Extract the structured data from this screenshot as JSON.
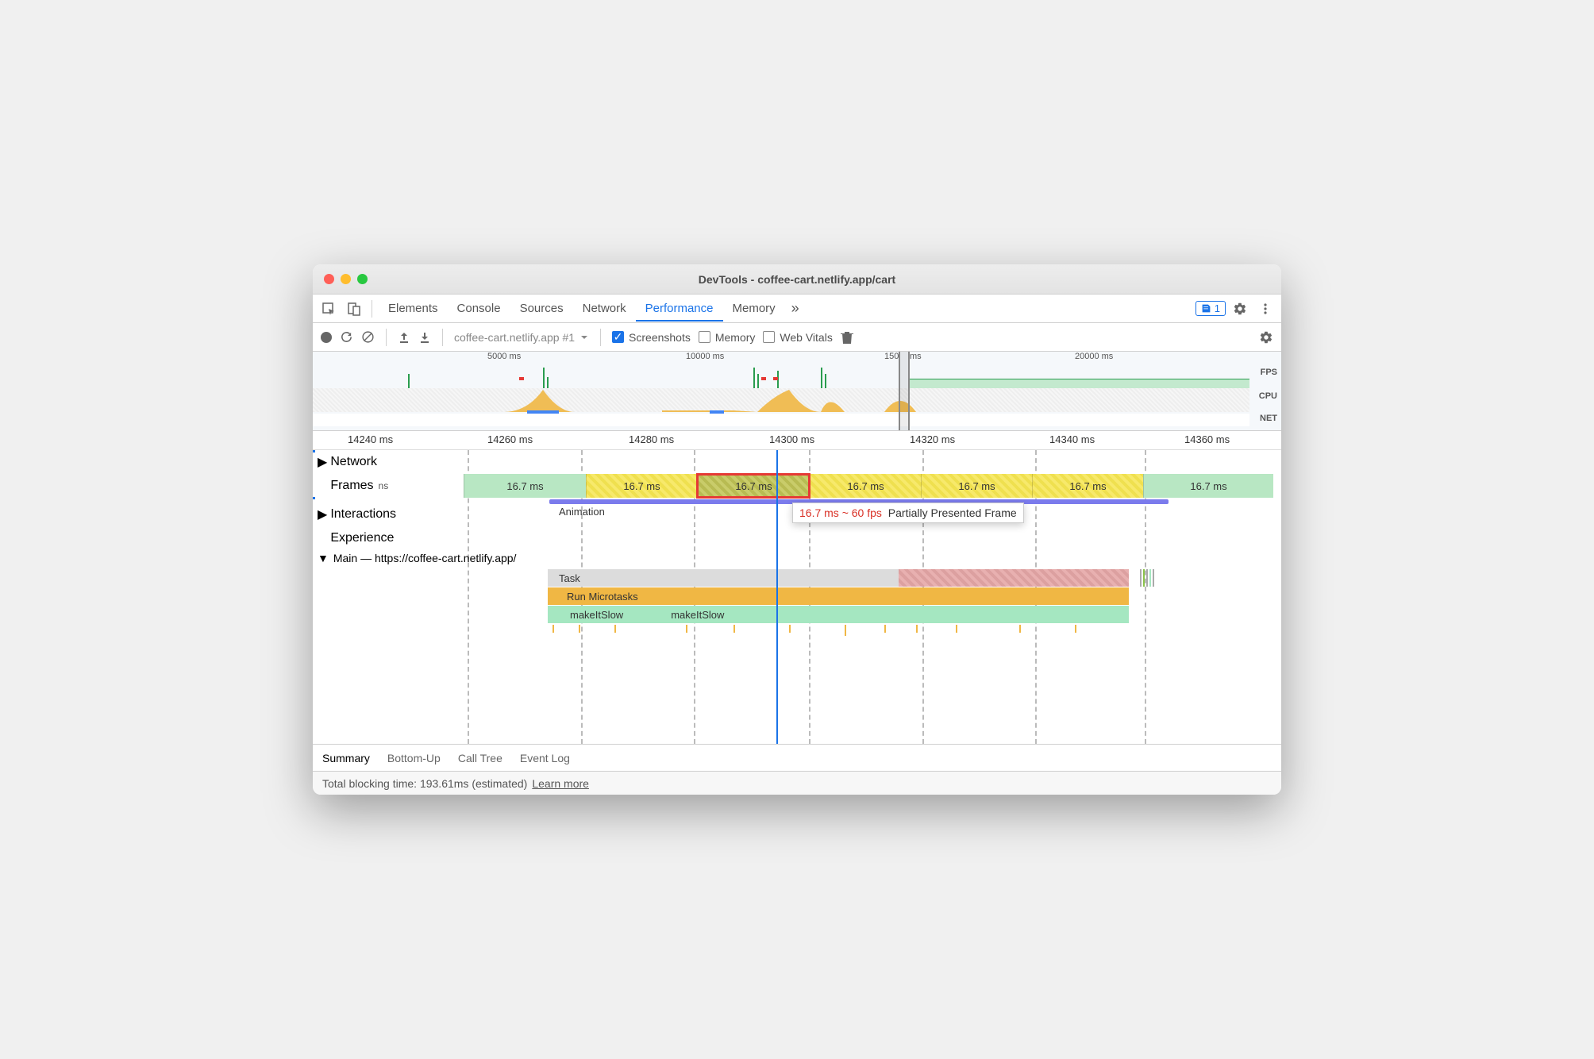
{
  "window": {
    "title": "DevTools - coffee-cart.netlify.app/cart"
  },
  "tabs": {
    "elements": "Elements",
    "console": "Console",
    "sources": "Sources",
    "network": "Network",
    "performance": "Performance",
    "memory": "Memory"
  },
  "badge": {
    "count": "1"
  },
  "toolbar": {
    "recording_select": "coffee-cart.netlify.app #1",
    "screenshots": "Screenshots",
    "memory": "Memory",
    "webvitals": "Web Vitals"
  },
  "overview": {
    "ticks": [
      "5000 ms",
      "10000 ms",
      "150",
      "ms",
      "20000 ms"
    ],
    "labels": {
      "fps": "FPS",
      "cpu": "CPU",
      "net": "NET"
    }
  },
  "ruler": {
    "ticks": [
      "14240 ms",
      "14260 ms",
      "14280 ms",
      "14300 ms",
      "14320 ms",
      "14340 ms",
      "14360 ms"
    ]
  },
  "tracks": {
    "network": "Network",
    "frames": "Frames",
    "frames_unit": "ns",
    "interactions": "Interactions",
    "animation": "Animation",
    "experience": "Experience",
    "main": "Main — https://coffee-cart.netlify.app/"
  },
  "frames": {
    "labels": [
      "16.7 ms",
      "16.7 ms",
      "16.7 ms",
      "16.7 ms",
      "16.7 ms",
      "16.7 ms",
      "16.7 ms"
    ]
  },
  "tooltip": {
    "timing": "16.7 ms ~ 60 fps",
    "status": "Partially Presented Frame"
  },
  "flame": {
    "task": "Task",
    "microtasks": "Run Microtasks",
    "slow1": "makeItSlow",
    "slow2": "makeItSlow"
  },
  "bottom_tabs": {
    "summary": "Summary",
    "bottomup": "Bottom-Up",
    "calltree": "Call Tree",
    "eventlog": "Event Log"
  },
  "status": {
    "text": "Total blocking time: 193.61ms (estimated)",
    "link": "Learn more"
  }
}
